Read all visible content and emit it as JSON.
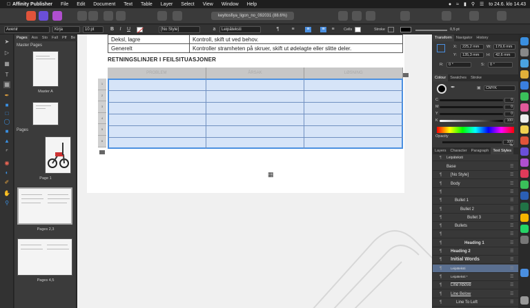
{
  "menubar": {
    "app_name": "Affinity Publisher",
    "menus": [
      "File",
      "Edit",
      "Document",
      "Text",
      "Table",
      "Layer",
      "Select",
      "View",
      "Window",
      "Help"
    ],
    "datetime": "to 24.6. klo 14.43"
  },
  "toolbar": {
    "document_title": "keyltosfiya_ligon_no_092031 (88.6%)"
  },
  "context_bar": {
    "font_family": "Avenir",
    "font_style": "Kirja",
    "font_size": "10 pt",
    "bold": "B",
    "italic": "I",
    "underline": "U",
    "char_style": "[No Style]",
    "para_style": "Leipäteksti",
    "cells_label": "Cells",
    "stroke_label": "Stroke",
    "stroke_width": "0,5 pt"
  },
  "pages_panel": {
    "tabs": [
      "Pages",
      "Ass",
      "Sto",
      "Fall",
      "Pff",
      "Be"
    ],
    "master_section": "Master Pages",
    "master_label": "Master A",
    "pages_section": "Pages",
    "page_labels": [
      "Page 1",
      "Pages 2,3",
      "Pages 4,5"
    ]
  },
  "canvas": {
    "top_table": [
      [
        "Deksl, lagre",
        "Kontroll, skift ut ved behov."
      ],
      [
        "Generelt",
        "Kontroller stramheten på skruer, skift ut ødelagte eller slitte deler."
      ]
    ],
    "heading": "RETNINGSLINJER I FEILSITUASJONER",
    "column_headers": [
      "PROBLEM",
      "ÅRSAK",
      "LØSNING"
    ],
    "row_numbers": [
      "1",
      "2",
      "3",
      "4",
      "5",
      "6"
    ]
  },
  "right_panel": {
    "transform_tabs": [
      "Transform",
      "Navigator",
      "History"
    ],
    "x_label": "X:",
    "x_value": "225,2 mm",
    "w_label": "W:",
    "w_value": "179,6 mm",
    "y_label": "Y:",
    "y_value": "135,3 mm",
    "h_label": "H:",
    "h_value": "42,6 mm",
    "r_label": "R:",
    "r_value": "0 °",
    "s_label": "S:",
    "s_value": "0 °",
    "colour_tabs": [
      "Colour",
      "Swatches",
      "Stroke"
    ],
    "colour_model": "CMYK",
    "channels": [
      {
        "label": "C",
        "value": "0"
      },
      {
        "label": "M",
        "value": "0"
      },
      {
        "label": "Y",
        "value": "0"
      },
      {
        "label": "K",
        "value": "100"
      }
    ],
    "opacity_label": "Opacity",
    "opacity_value": "100 %",
    "style_tabs": [
      "Layers",
      "Character",
      "Paragraph",
      "Text Styles"
    ],
    "current_style": "Leipäteksti",
    "styles": [
      "Base",
      "[No Style]",
      "Body",
      "",
      "Bullet 1",
      "Bullet 2",
      "Bullet 3",
      "Bullets",
      "",
      "Heading 1",
      "Heading 2",
      "Initial Words",
      "Leipäteksti",
      "Leipäteksti *",
      "Line Above",
      "Line Below",
      "Line To Left"
    ]
  },
  "colors": {
    "accent": "#4a8fe0",
    "table_fill": "#d6e4f8",
    "panel_bg": "#383838",
    "selected_style_bg": "#5a6f90"
  }
}
